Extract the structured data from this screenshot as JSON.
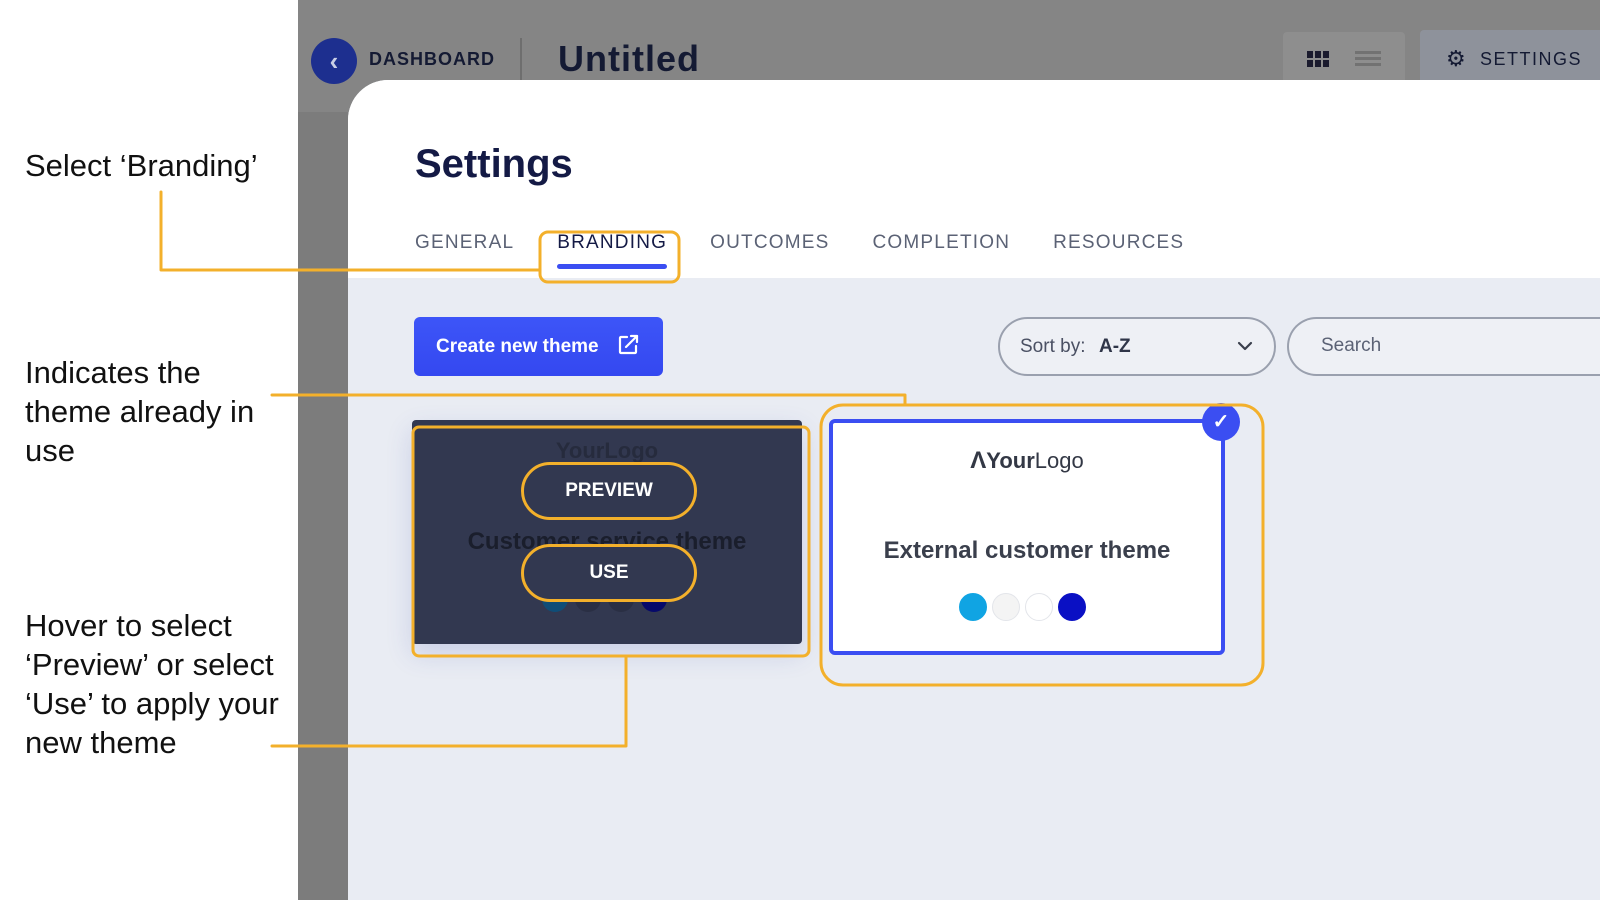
{
  "annotations": {
    "select_branding": "Select ‘Branding’",
    "indicates_theme": "Indicates the theme already in use",
    "hover_instructions": "Hover to select ‘Preview’ or select ‘Use’ to apply your new theme"
  },
  "header": {
    "back_icon": "chevron-left-icon",
    "dashboard_label": "DASHBOARD",
    "title": "Untitled",
    "grid_view_icon": "grid-icon",
    "list_view_icon": "list-icon",
    "settings_icon": "gear-icon",
    "settings_label": "SETTINGS"
  },
  "settings": {
    "title": "Settings",
    "tabs": [
      {
        "label": "GENERAL",
        "active": false
      },
      {
        "label": "BRANDING",
        "active": true
      },
      {
        "label": "OUTCOMES",
        "active": false
      },
      {
        "label": "COMPLETION",
        "active": false
      },
      {
        "label": "RESOURCES",
        "active": false
      }
    ],
    "create_button": "Create new theme",
    "create_icon": "external-link-icon",
    "sort": {
      "label": "Sort by:",
      "value": "A-Z"
    },
    "search": {
      "placeholder": "Search"
    }
  },
  "themes": [
    {
      "name": "Customer service theme",
      "logo": "YourLogo",
      "in_use": false,
      "hover_actions": [
        "PREVIEW",
        "USE"
      ],
      "swatches": [
        "#0f4d77",
        "#2a2f44",
        "#2a2f44",
        "#06096a"
      ]
    },
    {
      "name": "External customer theme",
      "logo_bold": "Your",
      "logo_light": "Logo",
      "in_use": true,
      "swatches": [
        "#10a4e3",
        "#f4f4f4",
        "#ffffff",
        "#0a10c4"
      ]
    }
  ],
  "colors": {
    "accent": "#3b4ef2",
    "highlight": "#f3b02b",
    "dark_card": "#323850"
  }
}
